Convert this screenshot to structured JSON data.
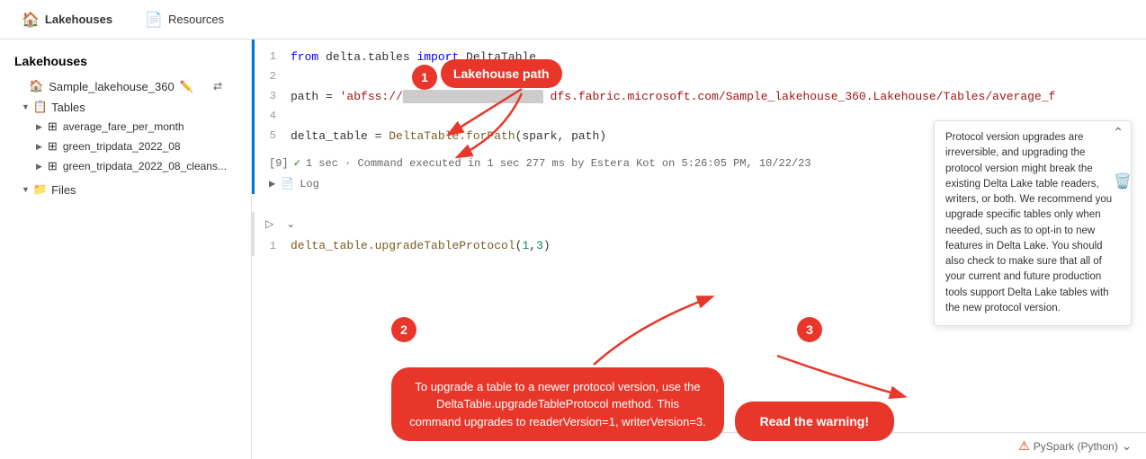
{
  "nav": {
    "lakehouses_label": "Lakehouses",
    "resources_label": "Resources"
  },
  "sidebar": {
    "title": "Lakehouses",
    "workspace": "Sample_lakehouse_360",
    "sections": [
      {
        "name": "Tables",
        "items": [
          "average_fare_per_month",
          "green_tripdata_2022_08",
          "green_tripdata_2022_08_cleans..."
        ]
      },
      {
        "name": "Files",
        "items": []
      }
    ]
  },
  "code_cell_1": {
    "lines": [
      {
        "num": "1",
        "content": "from delta.tables import DeltaTable"
      },
      {
        "num": "2",
        "content": ""
      },
      {
        "num": "3",
        "content": "path = 'abfss://██████████████████ dfs.fabric.microsoft.com/Sample_lakehouse_360.Lakehouse/Tables/average_f"
      },
      {
        "num": "4",
        "content": ""
      },
      {
        "num": "5",
        "content": "delta_table = DeltaTable.forPath(spark, path)"
      }
    ],
    "exec_num": "[9]",
    "exec_status": "1 sec · Command executed in 1 sec 277 ms by Estera Kot on 5:26:05 PM, 10/22/23",
    "log_label": "Log"
  },
  "code_cell_2": {
    "lines": [
      {
        "num": "1",
        "content": "delta_table.upgradeTableProtocol(1,3)"
      }
    ]
  },
  "warning": {
    "text": "Protocol version upgrades are irreversible, and upgrading the protocol version might break the existing Delta Lake table readers, writers, or both. We recommend you upgrade specific tables only when needed, such as to opt-in to new features in Delta Lake. You should also check to make sure that all of your current and future production tools support Delta Lake tables with the new protocol version."
  },
  "toolbar": {
    "language": "PySpark (Python)"
  },
  "annotations": {
    "bubble1": "1",
    "bubble1_label": "Lakehouse path",
    "bubble2": "2",
    "bubble2_text": "To upgrade a table to a newer protocol version, use the DeltaTable.upgradeTableProtocol method. This command upgrades to readerVersion=1, writerVersion=3.",
    "bubble3": "3",
    "bubble3_text": "Read the warning!"
  }
}
